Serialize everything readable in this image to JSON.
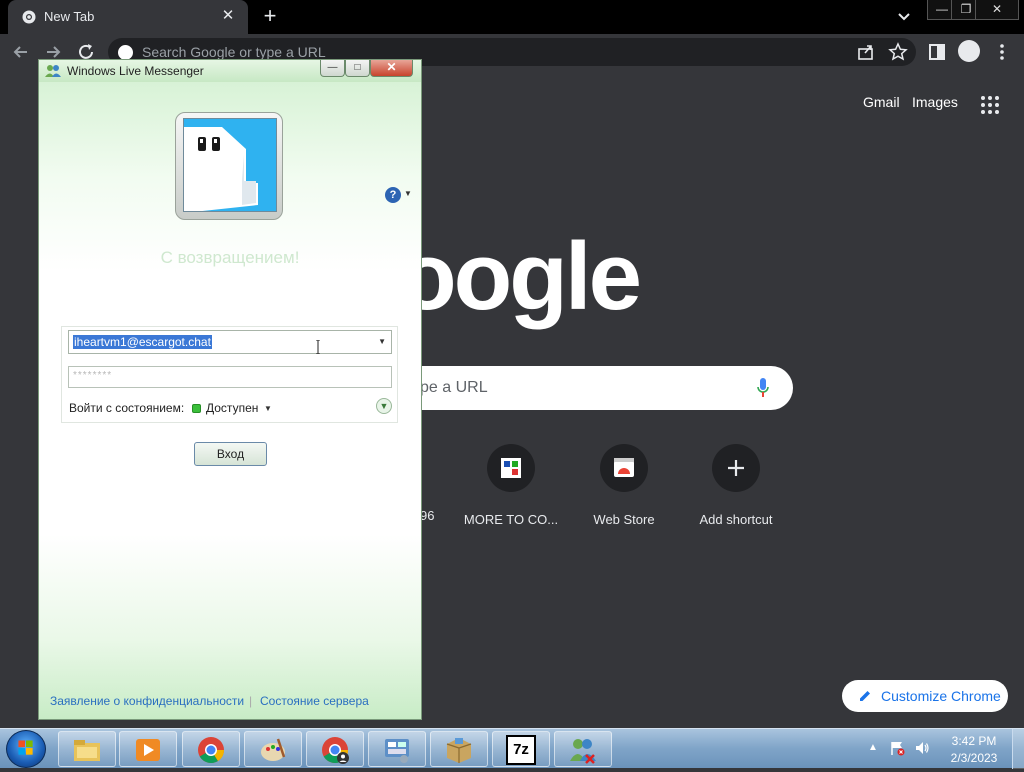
{
  "chrome": {
    "tab_title": "New Tab",
    "tab_close": "✕",
    "new_tab_glyph": "+",
    "window_controls": [
      "—",
      "❐",
      "✕"
    ],
    "omnibox_placeholder": "Search Google or type a URL",
    "toolbar_icons": [
      "back-icon",
      "forward-icon",
      "reload-icon",
      "share-icon",
      "star-icon",
      "side-panel-icon",
      "profile-icon",
      "kebab-menu-icon"
    ]
  },
  "newtab": {
    "gmail": "Gmail",
    "images": "Images",
    "logo_visible": "oogle",
    "search_placeholder_visible": "pe a URL",
    "partial_shortcut_label": "96",
    "shortcuts": [
      {
        "label": "MORE TO CO...",
        "icon": "site-favicon"
      },
      {
        "label": "Web Store",
        "icon": "web-store-icon"
      },
      {
        "label": "Add shortcut",
        "icon": "plus-icon"
      }
    ],
    "customize": "Customize Chrome"
  },
  "messenger": {
    "title": "Windows Live Messenger",
    "welcome": "С возвращением!",
    "email": "iheartvm1@escargot.chat",
    "password_mask": "********",
    "status_label": "Войти с состоянием:",
    "status_value": "Доступен",
    "signin_button": "Вход",
    "help_glyph": "?",
    "footer_privacy": "Заявление о конфиденциальности",
    "footer_separator": "|",
    "footer_status": "Состояние сервера",
    "status_color": "#3bbf3b"
  },
  "taskbar": {
    "pinned": [
      "explorer-icon",
      "media-player-icon",
      "chrome-icon",
      "paint-icon",
      "chrome-profile-icon",
      "control-panel-icon",
      "package-icon",
      "7zip-icon",
      "messenger-icon"
    ],
    "seven_zip_text": "7z",
    "tray_arrow": "▲",
    "time": "3:42 PM",
    "date": "2/3/2023"
  }
}
